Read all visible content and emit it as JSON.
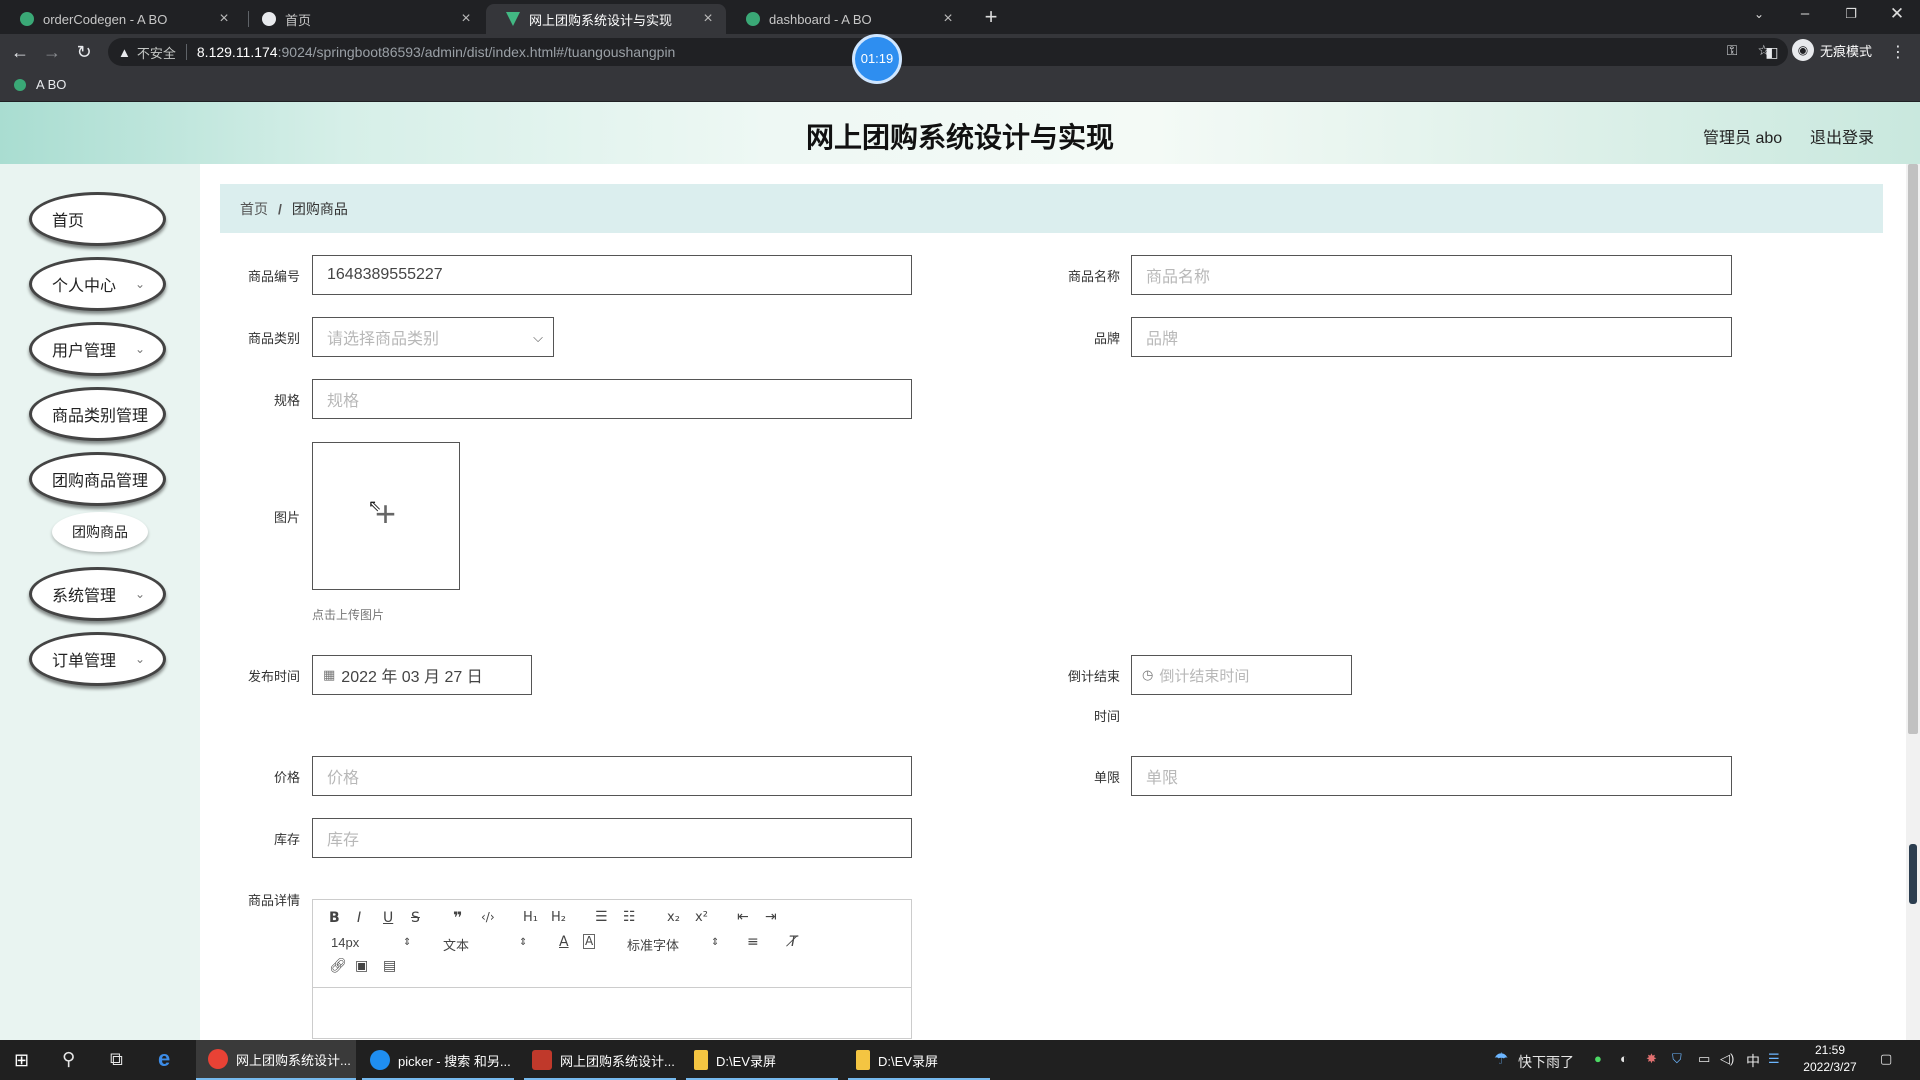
{
  "browser": {
    "tabs": [
      {
        "title": "orderCodegen - A BO",
        "icon_color": "#3aa876"
      },
      {
        "title": "首页",
        "icon_color": "#e8eaed"
      },
      {
        "title": "网上团购系统设计与实现",
        "icon_color": "#42b883"
      },
      {
        "title": "dashboard - A BO",
        "icon_color": "#3aa876"
      }
    ],
    "active_tab": 2,
    "security_label": "不安全",
    "url_host": "8.129.11.174",
    "url_rest": ":9024/springboot86593/admin/dist/index.html#/tuangoushangpin",
    "incognito_label": "无痕模式",
    "bookmark": "A BO",
    "recording_timer": "01:19"
  },
  "app": {
    "title": "网上团购系统设计与实现",
    "user_label": "管理员 abo",
    "logout_label": "退出登录"
  },
  "sidebar": {
    "items": [
      {
        "label": "首页",
        "has_children": false
      },
      {
        "label": "个人中心",
        "has_children": true
      },
      {
        "label": "用户管理",
        "has_children": true
      },
      {
        "label": "商品类别管理",
        "has_children": false
      },
      {
        "label": "团购商品管理",
        "has_children": false
      },
      {
        "label": "系统管理",
        "has_children": true
      },
      {
        "label": "订单管理",
        "has_children": true
      }
    ],
    "submenu_item": "团购商品"
  },
  "breadcrumb": {
    "home": "首页",
    "separator": "/",
    "current": "团购商品"
  },
  "form": {
    "code": {
      "label": "商品编号",
      "value": "1648389555227"
    },
    "name": {
      "label": "商品名称",
      "placeholder": "商品名称"
    },
    "category": {
      "label": "商品类别",
      "placeholder": "请选择商品类别"
    },
    "brand": {
      "label": "品牌",
      "placeholder": "品牌"
    },
    "spec": {
      "label": "规格",
      "placeholder": "规格"
    },
    "image": {
      "label": "图片",
      "tip": "点击上传图片"
    },
    "publish_time": {
      "label": "发布时间",
      "value": "2022 年 03 月 27 日"
    },
    "countdown_end": {
      "label_line1": "倒计结束",
      "label_line2": "时间",
      "placeholder": "倒计结束时间"
    },
    "price": {
      "label": "价格",
      "placeholder": "价格"
    },
    "limit": {
      "label": "单限",
      "placeholder": "单限"
    },
    "stock": {
      "label": "库存",
      "placeholder": "库存"
    },
    "detail": {
      "label": "商品详情"
    }
  },
  "editor": {
    "font_size": "14px",
    "header_type": "文本",
    "font_family": "标准字体"
  },
  "taskbar": {
    "apps": [
      {
        "title": "网上团购系统设计...",
        "icon_color": "#e94235"
      },
      {
        "title": "picker - 搜索 和另...",
        "icon_color": "#1f8ef1"
      },
      {
        "title": "网上团购系统设计...",
        "icon_color": "#c0392b"
      },
      {
        "title": "D:\\EV录屏",
        "icon_color": "#f4c542"
      },
      {
        "title": "D:\\EV录屏",
        "icon_color": "#f4c542"
      }
    ],
    "weather": "快下雨了",
    "ime": "中",
    "time": "21:59",
    "date": "2022/3/27"
  }
}
